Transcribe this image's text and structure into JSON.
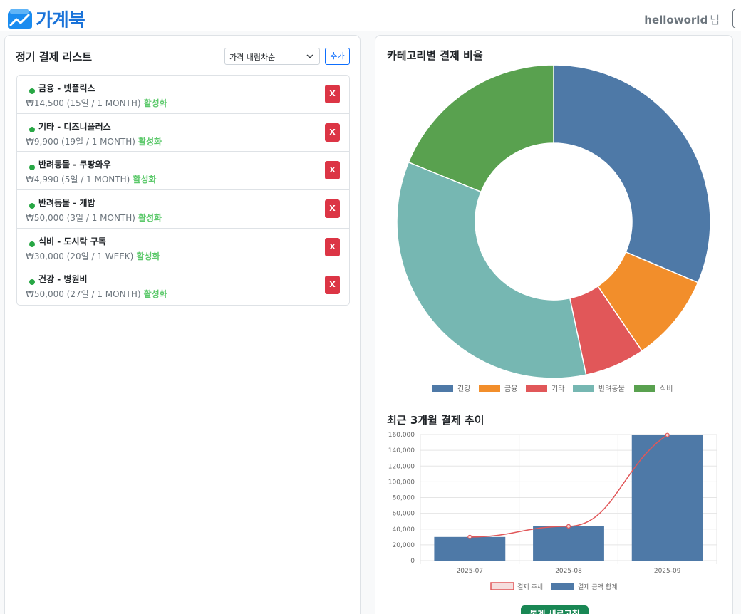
{
  "header": {
    "brand": "가계북",
    "username": "helloworld",
    "user_suffix": "님"
  },
  "subscriptions": {
    "title": "정기 결제 리스트",
    "sort_value": "가격 내림차순",
    "add_label": "추가",
    "delete_label": "X",
    "items": [
      {
        "name": "금융 - 넷플릭스",
        "detail": "₩14,500 (15일 / 1 MONTH)",
        "status": "활성화"
      },
      {
        "name": "기타 - 디즈니플러스",
        "detail": "₩9,900 (19일 / 1 MONTH)",
        "status": "활성화"
      },
      {
        "name": "반려동물 - 쿠팡와우",
        "detail": "₩4,990 (5일 / 1 MONTH)",
        "status": "활성화"
      },
      {
        "name": "반려동물 - 개밥",
        "detail": "₩50,000 (3일 / 1 MONTH)",
        "status": "활성화"
      },
      {
        "name": "식비 - 도시락 구독",
        "detail": "₩30,000 (20일 / 1 WEEK)",
        "status": "활성화"
      },
      {
        "name": "건강 - 병원비",
        "detail": "₩50,000 (27일 / 1 MONTH)",
        "status": "활성화"
      }
    ]
  },
  "charts": {
    "donut_title": "카테고리별 결제 비율",
    "trend_title": "최근 3개월 결제 추이",
    "bottom_button": "통계 새로고침"
  },
  "chart_data": [
    {
      "type": "pie",
      "categories": [
        "건강",
        "금융",
        "기타",
        "반려동물",
        "식비"
      ],
      "values": [
        50000,
        14500,
        9900,
        54990,
        30000
      ],
      "colors": [
        "#4e79a7",
        "#f28e2b",
        "#e15759",
        "#76b7b2",
        "#59a14f"
      ],
      "legend": "bottom"
    },
    {
      "type": "bar",
      "categories": [
        "2025-07",
        "2025-08",
        "2025-09"
      ],
      "series": [
        {
          "name": "결제 추세",
          "type": "line",
          "values": [
            30000,
            43500,
            159390
          ],
          "color": "#e15759"
        },
        {
          "name": "결제 금액 합계",
          "type": "bar",
          "values": [
            30000,
            43500,
            159390
          ],
          "color": "#4e79a7"
        }
      ],
      "ylim": [
        0,
        160000
      ],
      "yticks": [
        0,
        20000,
        40000,
        60000,
        80000,
        100000,
        120000,
        140000,
        160000
      ],
      "grid": true,
      "legend": "bottom"
    }
  ]
}
